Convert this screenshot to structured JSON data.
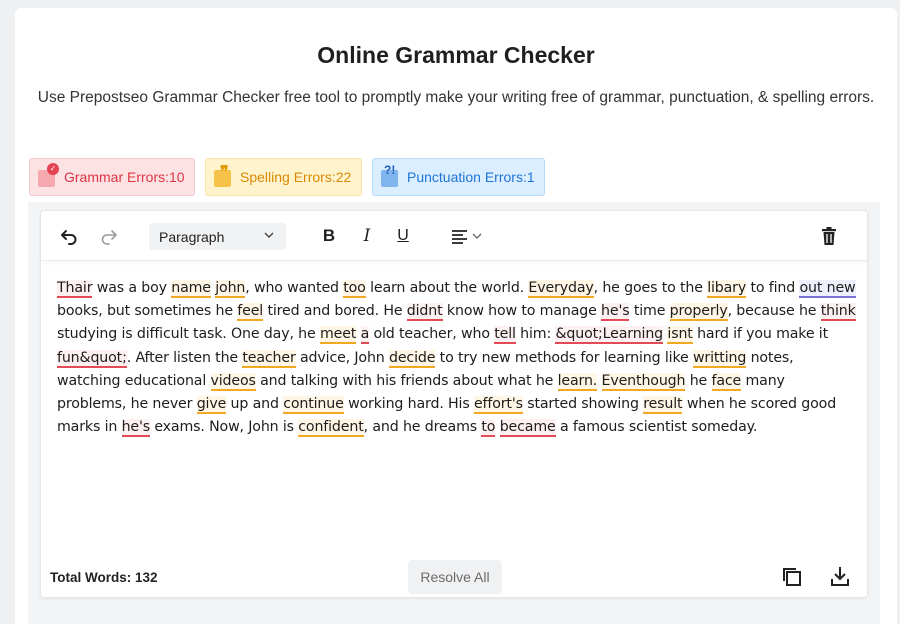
{
  "header": {
    "title": "Online Grammar Checker",
    "subtitle": "Use Prepostseo Grammar Checker free tool to promptly make your writing free of grammar, punctuation, & spelling errors."
  },
  "badges": {
    "grammar": "Grammar Errors:10",
    "spelling": "Spelling Errors:22",
    "punctuation": "Punctuation Errors:1"
  },
  "toolbar": {
    "block_format": "Paragraph",
    "bold_label": "B",
    "italic_label": "I",
    "underline_label": "U"
  },
  "editor": {
    "segments": [
      {
        "t": "Thair",
        "e": "r"
      },
      {
        "t": " was a boy "
      },
      {
        "t": "name",
        "e": "y"
      },
      {
        "t": " "
      },
      {
        "t": "john",
        "e": "y"
      },
      {
        "t": ", who wanted "
      },
      {
        "t": "too",
        "e": "y"
      },
      {
        "t": " learn about the world. "
      },
      {
        "t": "Everyday",
        "e": "y"
      },
      {
        "t": ", he goes to the "
      },
      {
        "t": "libary",
        "e": "y"
      },
      {
        "t": " to find "
      },
      {
        "t": "out new",
        "e": "p"
      },
      {
        "t": " books, but sometimes he "
      },
      {
        "t": "feel",
        "e": "y"
      },
      {
        "t": " tired and bored. He "
      },
      {
        "t": "didnt",
        "e": "r"
      },
      {
        "t": " know how to manage "
      },
      {
        "t": "he's",
        "e": "r"
      },
      {
        "t": " time "
      },
      {
        "t": "properly",
        "e": "y"
      },
      {
        "t": ", because he "
      },
      {
        "t": "think",
        "e": "r"
      },
      {
        "t": " studying is difficult task. One day, he "
      },
      {
        "t": "meet",
        "e": "y"
      },
      {
        "t": " "
      },
      {
        "t": "a",
        "e": "r"
      },
      {
        "t": " old teacher, who "
      },
      {
        "t": "tell",
        "e": "r"
      },
      {
        "t": " him: "
      },
      {
        "t": "&quot;Learning",
        "e": "r"
      },
      {
        "t": " "
      },
      {
        "t": "isnt",
        "e": "y"
      },
      {
        "t": " hard if you make it "
      },
      {
        "t": "fun&quot;",
        "e": "r"
      },
      {
        "t": "."
      },
      {
        "t": " After listen the "
      },
      {
        "t": "teacher",
        "e": "y"
      },
      {
        "t": " advice, John "
      },
      {
        "t": "decide",
        "e": "y"
      },
      {
        "t": " to try new methods for learning like "
      },
      {
        "t": "writting",
        "e": "y"
      },
      {
        "t": " notes, watching educational "
      },
      {
        "t": "videos",
        "e": "y"
      },
      {
        "t": " and talking with his friends about what he "
      },
      {
        "t": "learn.",
        "e": "y"
      },
      {
        "t": " "
      },
      {
        "t": "Eventhough",
        "e": "y"
      },
      {
        "t": " he "
      },
      {
        "t": "face",
        "e": "y"
      },
      {
        "t": " many problems, he never "
      },
      {
        "t": "give",
        "e": "y"
      },
      {
        "t": " up and "
      },
      {
        "t": "continue",
        "e": "y"
      },
      {
        "t": " working hard. His "
      },
      {
        "t": "effort's",
        "e": "y"
      },
      {
        "t": " started showing "
      },
      {
        "t": "result",
        "e": "y"
      },
      {
        "t": " when he scored good marks in "
      },
      {
        "t": "he's",
        "e": "r"
      },
      {
        "t": " exams. Now, John is "
      },
      {
        "t": "confident",
        "e": "y"
      },
      {
        "t": ", and he dreams "
      },
      {
        "t": "to",
        "e": "r"
      },
      {
        "t": " "
      },
      {
        "t": "became",
        "e": "r"
      },
      {
        "t": " a famous scientist someday."
      }
    ]
  },
  "footer": {
    "total_words": "Total Words: 132",
    "resolve_all": "Resolve All"
  },
  "icons": [
    "undo-icon",
    "redo-icon",
    "chevron-down-icon",
    "align-left-icon",
    "trash-icon",
    "copy-icon",
    "download-icon"
  ],
  "colors": {
    "grammar": "#dc3545",
    "spelling": "#f1a824",
    "punctuation": "#1f74d6",
    "style": "#7a72d8"
  }
}
